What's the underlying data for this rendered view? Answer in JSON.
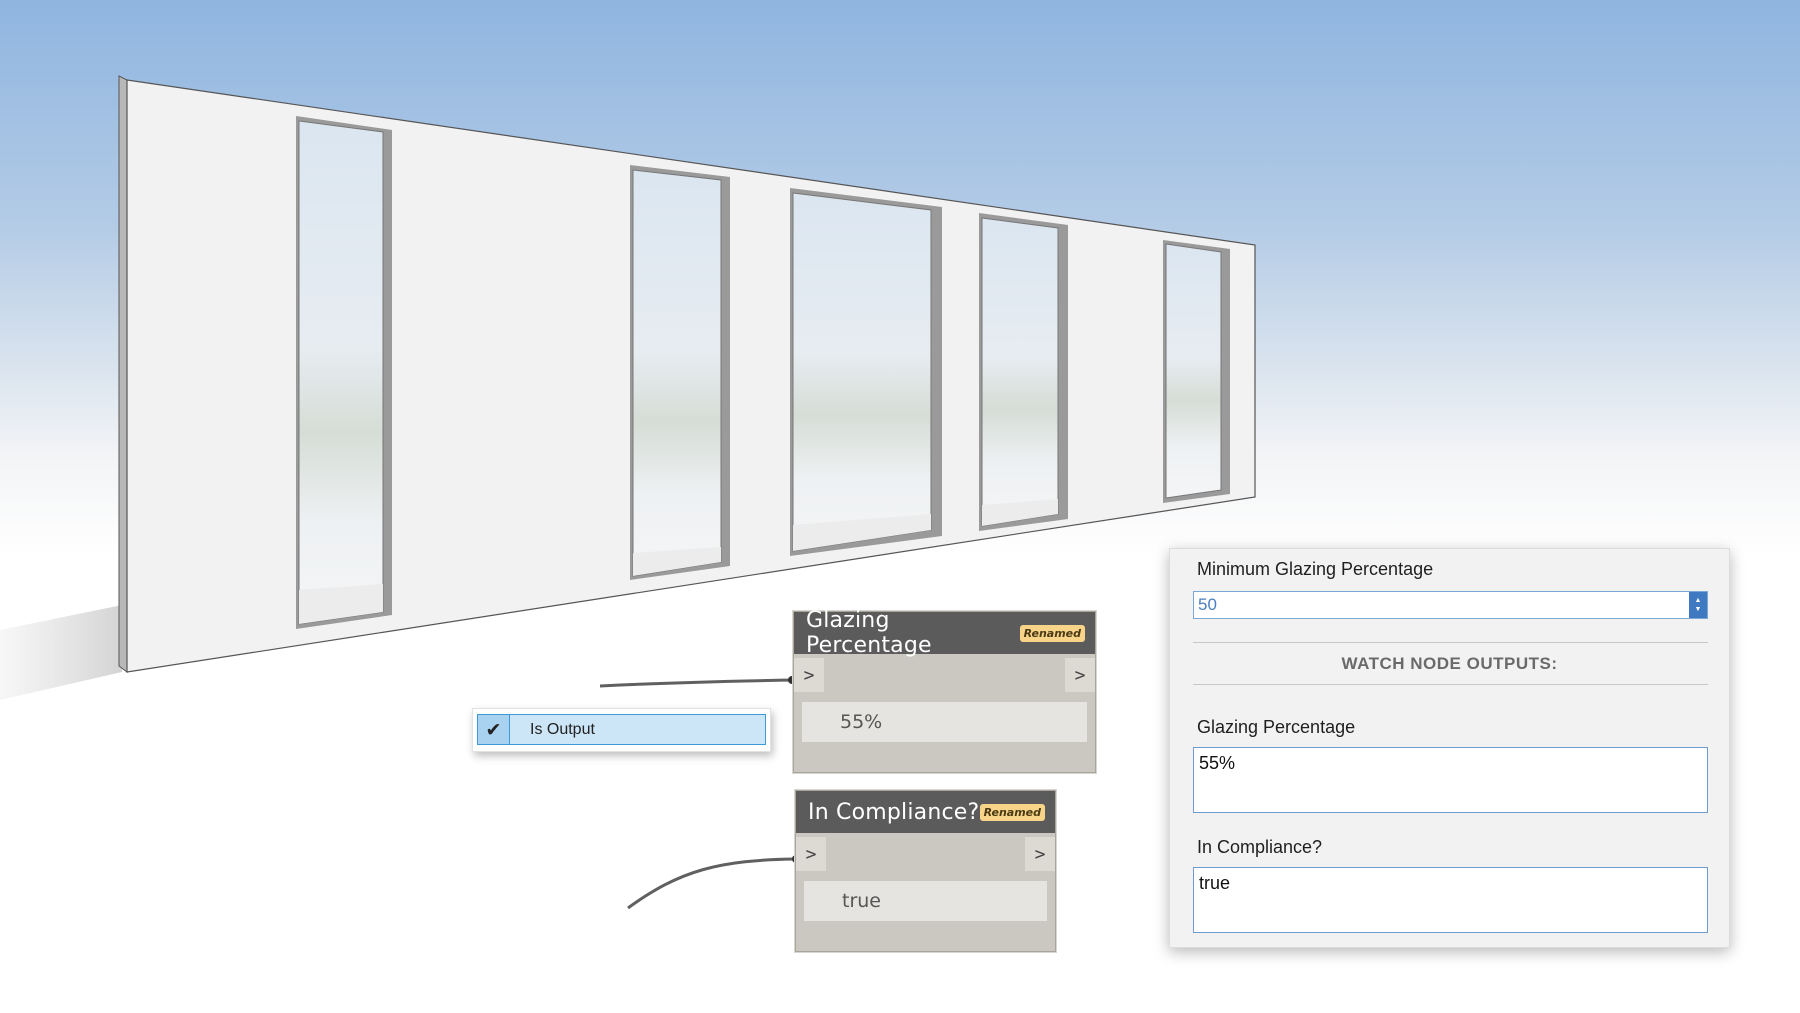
{
  "nodes": {
    "glazing": {
      "title": "Glazing Percentage",
      "badge": "Renamed",
      "in_port": ">",
      "out_port": ">",
      "value": "55%"
    },
    "compliance": {
      "title": "In Compliance?",
      "badge": "Renamed",
      "in_port": ">",
      "out_port": ">",
      "value": "true"
    }
  },
  "context_menu": {
    "item_label": "Is Output",
    "checked": true
  },
  "panel": {
    "min_label": "Minimum Glazing Percentage",
    "min_value": "50",
    "section_title": "WATCH NODE OUTPUTS:",
    "outputs": [
      {
        "label": "Glazing Percentage",
        "value": "55%"
      },
      {
        "label": "In Compliance?",
        "value": "true"
      }
    ]
  },
  "colors": {
    "sky": "#8fb5e0",
    "node_header": "#5b5b5b",
    "badge": "#f7d488",
    "accent_blue": "#3e79c1"
  }
}
